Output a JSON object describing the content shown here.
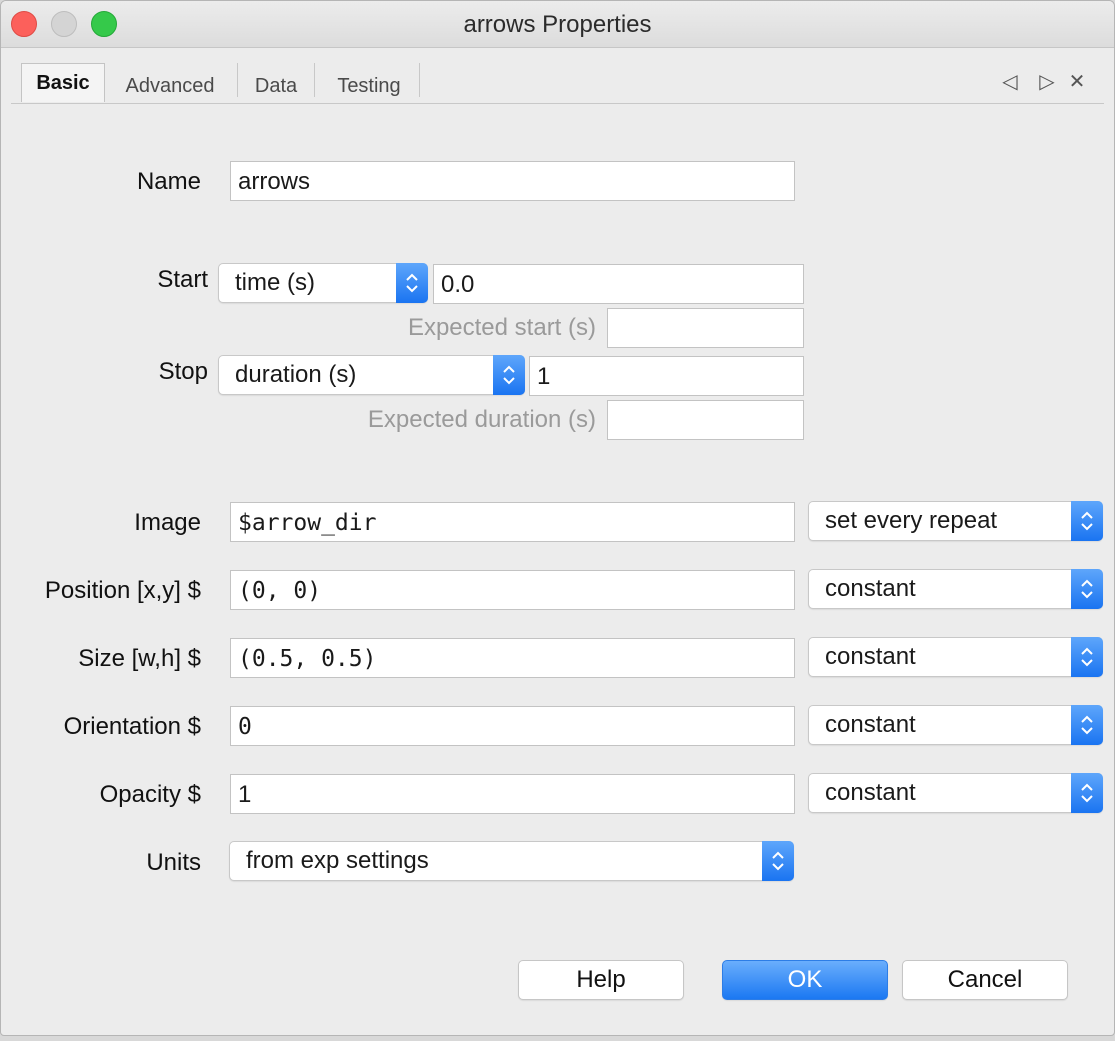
{
  "window": {
    "title": "arrows Properties"
  },
  "tabs": [
    {
      "label": "Basic"
    },
    {
      "label": "Advanced"
    },
    {
      "label": "Data"
    },
    {
      "label": "Testing"
    }
  ],
  "tab_nav": {
    "prev": "◁",
    "next": "▷",
    "close": "✕"
  },
  "form": {
    "name": {
      "label": "Name",
      "value": "arrows"
    },
    "start": {
      "label": "Start",
      "type": "time (s)",
      "value": "0.0",
      "expected_label": "Expected start (s)",
      "expected_value": ""
    },
    "stop": {
      "label": "Stop",
      "type": "duration (s)",
      "value": "1",
      "expected_label": "Expected duration (s)",
      "expected_value": ""
    },
    "image": {
      "label": "Image",
      "value": "$arrow_dir",
      "update": "set every repeat"
    },
    "position": {
      "label": "Position [x,y] $",
      "value": "(0, 0)",
      "update": "constant"
    },
    "size": {
      "label": "Size [w,h] $",
      "value": "(0.5, 0.5)",
      "update": "constant"
    },
    "orientation": {
      "label": "Orientation $",
      "value": "0",
      "update": "constant"
    },
    "opacity": {
      "label": "Opacity $",
      "value": "1",
      "update": "constant"
    },
    "units": {
      "label": "Units",
      "value": "from exp settings"
    }
  },
  "buttons": {
    "help": "Help",
    "ok": "OK",
    "cancel": "Cancel"
  },
  "colors": {
    "accent": "#1b78f2",
    "close": "#fc605b",
    "maximize": "#35c94a"
  }
}
